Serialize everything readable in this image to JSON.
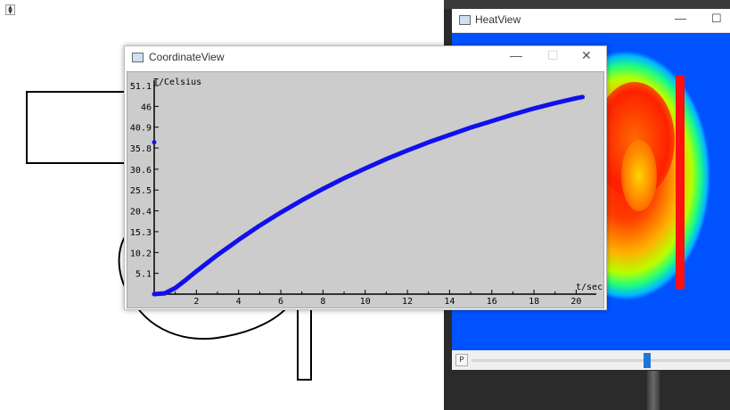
{
  "colors": {
    "plot_background": "#cccccc",
    "curve": "#1010ee",
    "heat_bar": "#ff1111",
    "slider_handle": "#1e78d7"
  },
  "spin_box": {
    "icon": "spin-arrows-icon"
  },
  "coordinate_window": {
    "title": "CoordinateView",
    "minimize": "—",
    "maximize": "☐",
    "close": "✕",
    "icon": "app-window-icon"
  },
  "heat_window": {
    "title": "HeatView",
    "minimize": "—",
    "maximize": "☐",
    "slider_button": "P",
    "slider_value": 0.68,
    "icon": "app-window-icon"
  },
  "chart_data": {
    "type": "line",
    "xlabel": "t/sec",
    "ylabel": "T/Celsius",
    "x_ticks": [
      2,
      4,
      6,
      8,
      10,
      12,
      14,
      16,
      18,
      20
    ],
    "x_tick_labels": [
      "2",
      "4",
      "6",
      "8",
      "10",
      "12",
      "14",
      "16",
      "18",
      "20"
    ],
    "y_ticks": [
      5.1,
      10.2,
      15.3,
      20.4,
      25.5,
      30.6,
      35.8,
      40.9,
      46,
      51.1
    ],
    "y_tick_labels": [
      "5.1",
      "10.2",
      "15.3",
      "20.4",
      "25.5",
      "30.6",
      "35.8",
      "40.9",
      "46",
      "51.1"
    ],
    "xlim": [
      0,
      20.7
    ],
    "ylim": [
      0,
      51.1
    ],
    "grid": false,
    "series": [
      {
        "x": [
          0,
          0.5,
          1,
          1.5,
          2,
          3,
          4,
          5,
          6,
          7,
          8,
          9,
          10,
          11,
          12,
          13,
          14,
          15,
          16,
          17,
          18,
          19,
          20,
          20.3
        ],
        "y": [
          0,
          0.2,
          1.5,
          3.5,
          5.6,
          9.6,
          13.3,
          16.8,
          20.0,
          23.0,
          25.8,
          28.4,
          30.8,
          33.1,
          35.2,
          37.2,
          39.0,
          40.8,
          42.4,
          44.0,
          45.5,
          46.8,
          48.0,
          48.3
        ]
      }
    ],
    "annotation": {
      "x": 0,
      "y": 37.2,
      "label": ""
    }
  }
}
